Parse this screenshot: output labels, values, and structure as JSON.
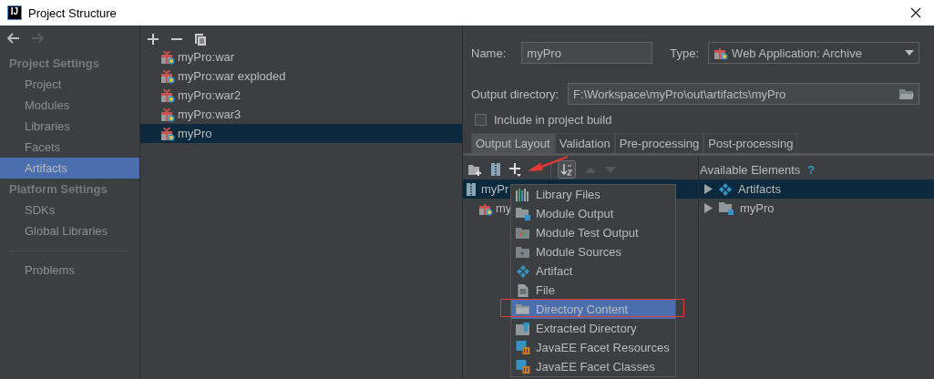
{
  "window": {
    "title": "Project Structure",
    "app_icon_text": "IJ"
  },
  "sidebar": {
    "sections": [
      {
        "title": "Project Settings",
        "items": [
          {
            "label": "Project",
            "selected": false
          },
          {
            "label": "Modules",
            "selected": false
          },
          {
            "label": "Libraries",
            "selected": false
          },
          {
            "label": "Facets",
            "selected": false
          },
          {
            "label": "Artifacts",
            "selected": true
          }
        ]
      },
      {
        "title": "Platform Settings",
        "items": [
          {
            "label": "SDKs",
            "selected": false
          },
          {
            "label": "Global Libraries",
            "selected": false
          }
        ]
      }
    ],
    "extra_items": [
      {
        "label": "Problems",
        "selected": false
      }
    ]
  },
  "artifacts": [
    {
      "label": "myPro:war",
      "selected": false
    },
    {
      "label": "myPro:war exploded",
      "selected": false
    },
    {
      "label": "myPro:war2",
      "selected": false
    },
    {
      "label": "myPro:war3",
      "selected": false
    },
    {
      "label": "myPro",
      "selected": true
    }
  ],
  "detail": {
    "name_label": "Name:",
    "name_value": "myPro",
    "type_label": "Type:",
    "type_value": "Web Application: Archive",
    "output_label": "Output directory:",
    "output_value": "F:\\Workspace\\myPro\\out\\artifacts\\myPro",
    "include_build": {
      "label": "Include in project build",
      "checked": false
    },
    "tabs": [
      {
        "label": "Output Layout",
        "selected": true
      },
      {
        "label": "Validation",
        "selected": false
      },
      {
        "label": "Pre-processing",
        "selected": false
      },
      {
        "label": "Post-processing",
        "selected": false
      }
    ],
    "layout_tree": [
      {
        "label": "myPr",
        "kind": "archive",
        "selected": true,
        "children": [
          {
            "label": "my",
            "kind": "gift",
            "selected": false
          }
        ]
      }
    ],
    "available_label": "Available Elements",
    "help_mark": "?",
    "available_elements": [
      {
        "label": "Artifacts",
        "kind": "artifact",
        "selected": true
      },
      {
        "label": "myPro",
        "kind": "module",
        "selected": false
      }
    ],
    "add_menu": [
      {
        "label": "Library Files",
        "kind": "library",
        "selected": false
      },
      {
        "label": "Module Output",
        "kind": "module",
        "selected": false
      },
      {
        "label": "Module Test Output",
        "kind": "test",
        "selected": false
      },
      {
        "label": "Module Sources",
        "kind": "sources",
        "selected": false
      },
      {
        "label": "Artifact",
        "kind": "artifact",
        "selected": false
      },
      {
        "label": "File",
        "kind": "file",
        "selected": false
      },
      {
        "label": "Directory Content",
        "kind": "folder",
        "selected": true
      },
      {
        "label": "Extracted Directory",
        "kind": "extract",
        "selected": false
      },
      {
        "label": "JavaEE Facet Resources",
        "kind": "facet",
        "selected": false
      },
      {
        "label": "JavaEE Facet Classes",
        "kind": "facet",
        "selected": false
      }
    ]
  }
}
